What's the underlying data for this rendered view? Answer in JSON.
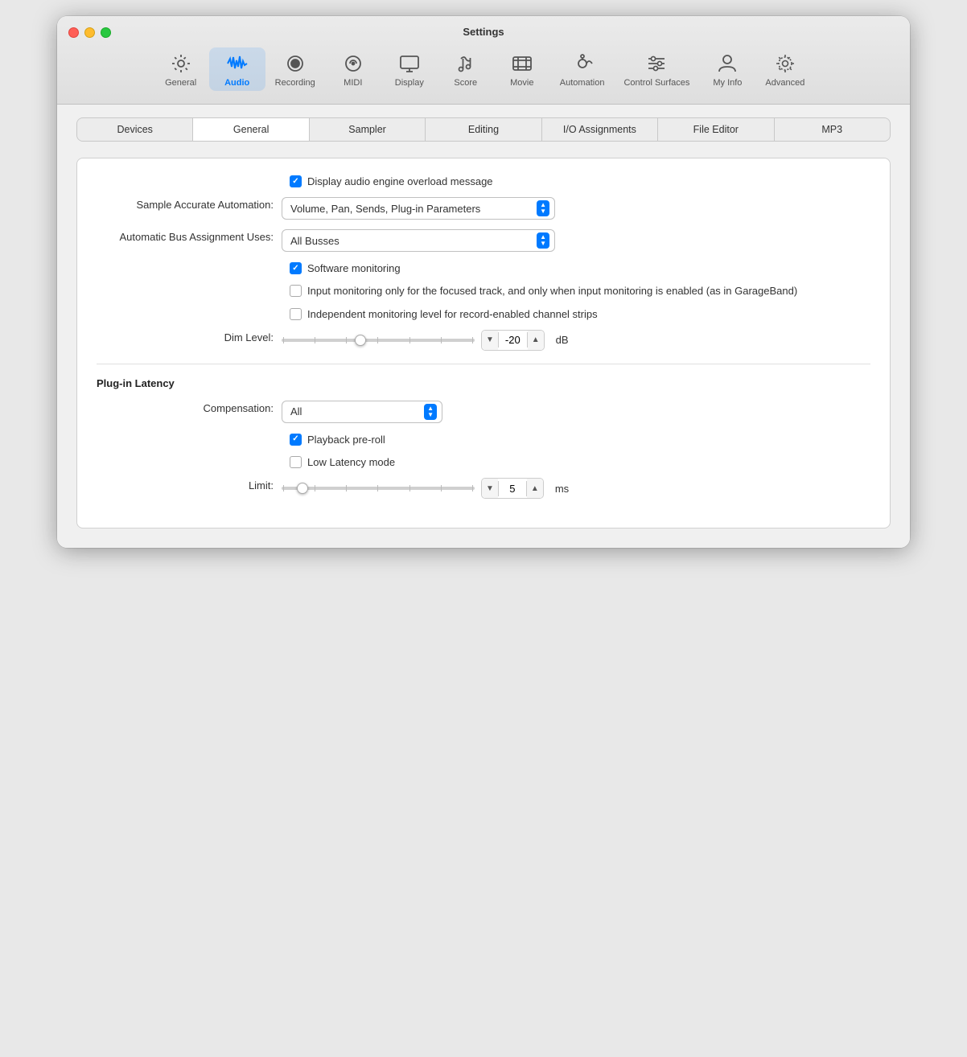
{
  "window": {
    "title": "Settings"
  },
  "toolbar": {
    "items": [
      {
        "id": "general",
        "label": "General",
        "icon": "gear",
        "active": false
      },
      {
        "id": "audio",
        "label": "Audio",
        "icon": "waveform",
        "active": true
      },
      {
        "id": "recording",
        "label": "Recording",
        "icon": "record",
        "active": false
      },
      {
        "id": "midi",
        "label": "MIDI",
        "icon": "midi",
        "active": false
      },
      {
        "id": "display",
        "label": "Display",
        "icon": "display",
        "active": false
      },
      {
        "id": "score",
        "label": "Score",
        "icon": "score",
        "active": false
      },
      {
        "id": "movie",
        "label": "Movie",
        "icon": "movie",
        "active": false
      },
      {
        "id": "automation",
        "label": "Automation",
        "icon": "automation",
        "active": false
      },
      {
        "id": "control-surfaces",
        "label": "Control Surfaces",
        "icon": "sliders",
        "active": false
      },
      {
        "id": "my-info",
        "label": "My Info",
        "icon": "person",
        "active": false
      },
      {
        "id": "advanced",
        "label": "Advanced",
        "icon": "advanced-gear",
        "active": false
      }
    ]
  },
  "tabs": [
    {
      "id": "devices",
      "label": "Devices",
      "active": false
    },
    {
      "id": "general",
      "label": "General",
      "active": true
    },
    {
      "id": "sampler",
      "label": "Sampler",
      "active": false
    },
    {
      "id": "editing",
      "label": "Editing",
      "active": false
    },
    {
      "id": "io-assignments",
      "label": "I/O Assignments",
      "active": false
    },
    {
      "id": "file-editor",
      "label": "File Editor",
      "active": false
    },
    {
      "id": "mp3",
      "label": "MP3",
      "active": false
    }
  ],
  "settings": {
    "display_overload_message": {
      "label": "Display audio engine overload message",
      "checked": true
    },
    "sample_accurate_automation": {
      "label": "Sample Accurate Automation:",
      "value": "Volume, Pan, Sends, Plug-in Parameters"
    },
    "automatic_bus_assignment": {
      "label": "Automatic Bus Assignment Uses:",
      "value": "All Busses"
    },
    "software_monitoring": {
      "label": "Software monitoring",
      "checked": true
    },
    "input_monitoring_focused": {
      "label": "Input monitoring only for the focused track, and only when input monitoring is enabled (as in GarageBand)",
      "checked": false
    },
    "independent_monitoring": {
      "label": "Independent monitoring level for record-enabled channel strips",
      "checked": false
    },
    "dim_level": {
      "label": "Dim Level:",
      "value": "-20",
      "unit": "dB"
    }
  },
  "plugin_latency": {
    "section_title": "Plug-in Latency",
    "compensation": {
      "label": "Compensation:",
      "value": "All"
    },
    "playback_preroll": {
      "label": "Playback pre-roll",
      "checked": true
    },
    "low_latency_mode": {
      "label": "Low Latency mode",
      "checked": false
    },
    "limit": {
      "label": "Limit:",
      "value": "5",
      "unit": "ms"
    }
  }
}
